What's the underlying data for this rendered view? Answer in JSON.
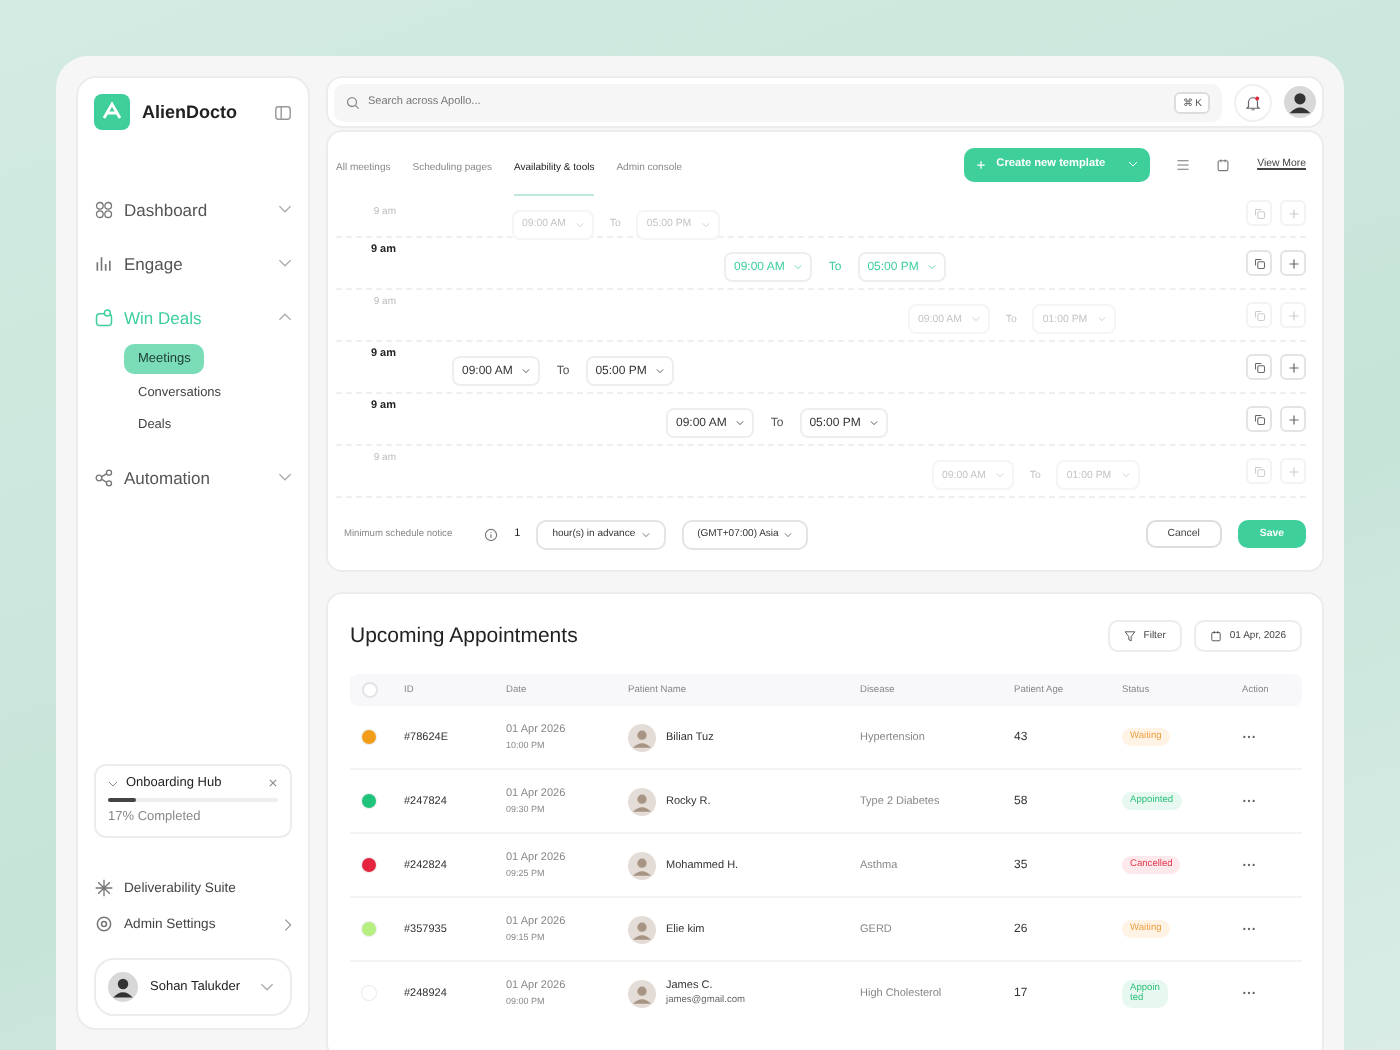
{
  "sidebar": {
    "brand": "AlienDocto",
    "nav": [
      {
        "label": "Dashboard",
        "selected": false,
        "expanded": false
      },
      {
        "label": "Engage",
        "selected": false,
        "expanded": false
      },
      {
        "label": "Win Deals",
        "selected": true,
        "expanded": true,
        "children": [
          {
            "label": "Meetings",
            "selected": true
          },
          {
            "label": "Conversations",
            "selected": false
          },
          {
            "label": "Deals",
            "selected": false
          }
        ]
      },
      {
        "label": "Automation",
        "selected": false,
        "expanded": false
      }
    ],
    "onboarding": {
      "title": "Onboarding Hub",
      "level": 0.17,
      "progress_text": "17% Completed"
    },
    "links": [
      {
        "label": "Deliverability Suite",
        "has_arrow": false
      },
      {
        "label": "Admin Settings",
        "has_arrow": true
      }
    ],
    "user": {
      "name": "Sohan Talukder"
    }
  },
  "topbar": {
    "search": {
      "placeholder": "Search across Apollo...",
      "shortcut": "⌘ K"
    },
    "notification_unread": true
  },
  "scheduler": {
    "tabs": [
      {
        "label": "All meetings",
        "selected": false
      },
      {
        "label": "Scheduling pages",
        "selected": false
      },
      {
        "label": "Availability & tools",
        "selected": true
      },
      {
        "label": "Admin console",
        "selected": false
      }
    ],
    "create_button": "Create new template",
    "view_more": "View More",
    "rows": [
      {
        "time_label": "9 am",
        "kind": "faded",
        "start": "09:00 AM",
        "to": "To",
        "end": "05:00 PM"
      },
      {
        "time_label": "9 am",
        "kind": "active",
        "start": "09:00 AM",
        "to": "To",
        "end": "05:00 PM"
      },
      {
        "time_label": "9 am",
        "kind": "faded",
        "start": "09:00 AM",
        "to": "To",
        "end": "01:00 PM"
      },
      {
        "time_label": "9 am",
        "kind": "normal",
        "start": "09:00 AM",
        "to": "To",
        "end": "05:00 PM"
      },
      {
        "time_label": "9 am",
        "kind": "normal",
        "start": "09:00 AM",
        "to": "To",
        "end": "05:00 PM"
      },
      {
        "time_label": "9 am",
        "kind": "faded",
        "start": "09:00 AM",
        "to": "To",
        "end": "01:00 PM"
      }
    ],
    "notice": {
      "label": "Minimum schedule notice",
      "value": "1",
      "unit": "hour(s) in advance",
      "timezone": "(GMT+07:00) Asia"
    },
    "actions": [
      {
        "label": "Cancel",
        "kind": "secondary"
      },
      {
        "label": "Save",
        "kind": "primary"
      }
    ]
  },
  "appointments": {
    "title": "Upcoming Appointments",
    "filter": "Filter",
    "date": "01 Apr, 2026",
    "header_checked": false,
    "columns": [
      "ID",
      "Date",
      "Patient Name",
      "Disease",
      "Patient Age",
      "Status",
      "Action"
    ],
    "rows": [
      {
        "color": "#f29d1a",
        "id": "#78624E",
        "date": "01 Apr 2026",
        "time": "10:00 PM",
        "patient": "Bilian Tuz",
        "disease": "Hypertension",
        "age": "43",
        "status": "Waiting",
        "kind": "waiting"
      },
      {
        "color": "#1fc37a",
        "id": "#247824",
        "date": "01 Apr 2026",
        "time": "09:30 PM",
        "patient": "Rocky R.",
        "disease": "Type 2 Diabetes",
        "age": "58",
        "status": "Appointed",
        "kind": "appointed"
      },
      {
        "color": "#e5253f",
        "id": "#242824",
        "date": "01 Apr 2026",
        "time": "09:25 PM",
        "patient": "Mohammed H.",
        "disease": "Asthma",
        "age": "35",
        "status": "Cancelled",
        "kind": "cancelled"
      },
      {
        "color": "#b5ef7f",
        "id": "#357935",
        "date": "01 Apr 2026",
        "time": "09:15 PM",
        "patient": "Elie kim",
        "disease": "GERD",
        "age": "26",
        "status": "Waiting",
        "kind": "waiting"
      },
      {
        "color": "#ffffff",
        "id": "#248924",
        "date": "01 Apr 2026",
        "time": "09:00 PM",
        "patient": "James C.",
        "email": "james@gmail.com",
        "disease": "High Cholesterol",
        "age": "17",
        "status": "Appoin ted",
        "kind": "appointed"
      }
    ]
  }
}
